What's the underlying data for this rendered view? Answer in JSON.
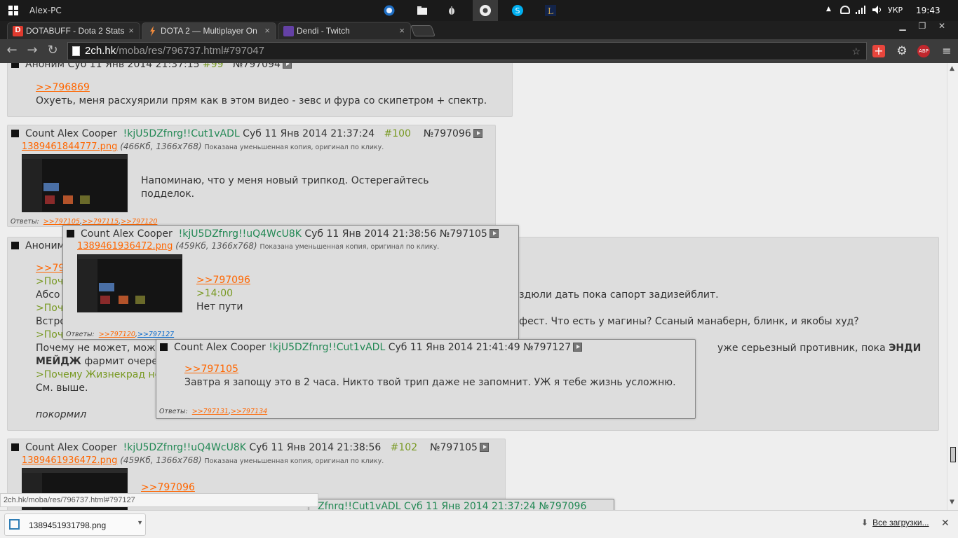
{
  "taskbar": {
    "title": "Alex-PC",
    "lang": "УКР",
    "time": "19:43"
  },
  "tabs": [
    {
      "label": "DOTABUFF - Dota 2 Stats",
      "favicon_color": "#e03a2e"
    },
    {
      "label": "DOTA 2 — Multiplayer On",
      "favicon_color": "#f08a3c"
    },
    {
      "label": "Dendi - Twitch",
      "favicon_color": "#6441a5"
    }
  ],
  "omnibox": {
    "host": "2ch.hk",
    "path": "/moba/res/796737.html#797047"
  },
  "abp_badge": "ABP",
  "post99": {
    "header": "Аноним  Суб 11 Янв 2014 21:37:15  ",
    "num": "#99",
    "id": "№797094",
    "link": ">>796869",
    "text": "Охуеть, меня расхуярили прям как в этом видео - зевс и фура со скипетром + спектр."
  },
  "post100": {
    "name": "Count Alex Cooper",
    "trip": "!kjU5DZfnrg!!Cut1vADL",
    "date": "Суб 11 Янв 2014 21:37:24",
    "num": "#100",
    "id": "№797096",
    "file": "1389461844777.png",
    "file_meta": "(466Кб, 1366x768)",
    "file_note": "Показана уменьшенная копия, оригинал по клику.",
    "text1": "Напоминаю, что у меня новый трипкод. Остерегайтесь",
    "text2": "подделок.",
    "replies_label": "Ответы:",
    "replies": [
      ">>797105",
      ">>797115",
      ">>797120"
    ]
  },
  "post101": {
    "header": "Аноним",
    "l1": ">>79",
    "l2": ">Поч",
    "l3a": "Абсо",
    "l3b": "издюли дать пока сапорт задизейблит.",
    "l4": ">Поч",
    "l5a": "Встро",
    "l5b": "нфест. Что есть у магины? Ссаный манаберн, блинк, и якобы худ?",
    "l6": ">Поч",
    "l7a": "Почему не может, може",
    "l7b": "уже серьезный противник, пока ",
    "l7c": "ЭНДИ",
    "l8a": "МЕЙДЖ",
    "l8b": " фармит очеред",
    "l9": ">Почему Жизнекрад не",
    "l10": "См. выше.",
    "l11": "покормил"
  },
  "popup1": {
    "name": "Count Alex Cooper",
    "trip": "!kjU5DZfnrg!!uQ4WcU8K",
    "date": "Суб 11 Янв 2014 21:38:56",
    "id": "№797105",
    "file": "1389461936472.png",
    "file_meta": "(459Кб, 1366x768)",
    "file_note": "Показана уменьшенная копия, оригинал по клику.",
    "link": ">>797096",
    "quote": ">14:00",
    "text": "Нет пути",
    "replies_label": "Ответы:",
    "reply_a": ">>797120",
    "reply_b": ">>797127"
  },
  "popup2": {
    "name": "Count Alex Cooper",
    "trip": "!kjU5DZfnrg!!Cut1vADL",
    "date": "Суб 11 Янв 2014 21:41:49",
    "id": "№797127",
    "link": ">>797105",
    "text": "Завтра я запощу это в 2 часа. Никто твой трип даже не запомнит. УЖ я тебе жизнь усложню.",
    "replies_label": "Ответы:",
    "replies": [
      ">>797131",
      ">>797134"
    ]
  },
  "post102": {
    "name": "Count Alex Cooper",
    "trip": "!kjU5DZfnrg!!uQ4WcU8K",
    "date": "Суб 11 Янв 2014 21:38:56",
    "num": "#102",
    "id": "№797105",
    "file": "1389461936472.png",
    "file_meta": "(459Кб, 1366x768)",
    "file_note": "Показана уменьшенная копия, оригинал по клику.",
    "partial_link": ">>797096"
  },
  "hidden_header": "Zfnrg!!Cut1vADL  Суб 11 Янв 2014 21:37:24 №797096",
  "status_url": "2ch.hk/moba/res/796737.html#797127",
  "downloads": {
    "file": "1389451931798.png",
    "all_label": "Все загрузки..."
  }
}
